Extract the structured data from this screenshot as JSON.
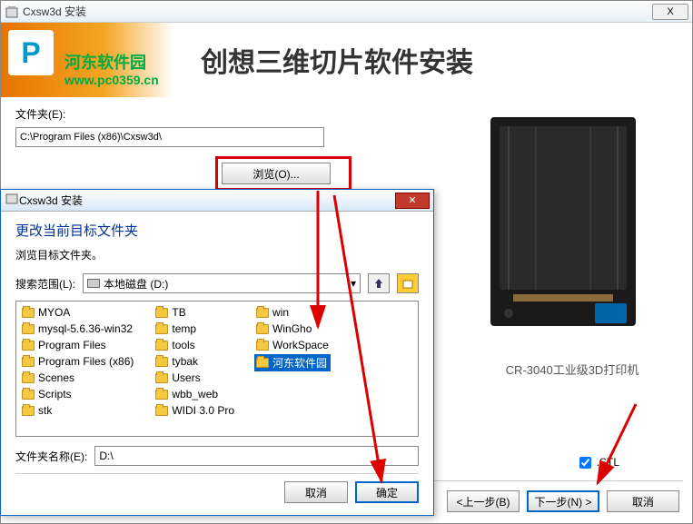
{
  "main_window": {
    "title": "Cxsw3d 安装",
    "close": "X"
  },
  "banner": {
    "title": "创想三维切片软件安装",
    "watermark_text": "河东软件园",
    "watermark_url": "www.pc0359.cn"
  },
  "folder": {
    "label": "文件夹(E):",
    "path": "C:\\Program Files (x86)\\Cxsw3d\\",
    "browse": "浏览(O)..."
  },
  "printer": {
    "caption": "CR-3040工业级3D打印机"
  },
  "stl_label": ".STL",
  "main_buttons": {
    "back": "<上一步(B)",
    "next": "下一步(N) >",
    "cancel": "取消"
  },
  "browse_dialog": {
    "title": "Cxsw3d 安装",
    "heading": "更改当前目标文件夹",
    "sub": "浏览目标文件夹。",
    "search_label": "搜索范围(L):",
    "drive": "本地磁盘 (D:)",
    "name_label": "文件夹名称(E):",
    "name_value": "D:\\",
    "cancel": "取消",
    "ok": "确定",
    "folders_col1": [
      "MYOA",
      "mysql-5.6.36-win32",
      "Program Files",
      "Program Files (x86)",
      "Scenes",
      "Scripts",
      "stk"
    ],
    "folders_col2": [
      "TB",
      "temp",
      "tools",
      "tybak",
      "Users",
      "wbb_web",
      "WIDI 3.0 Pro"
    ],
    "folders_col3": [
      "win",
      "WinGho",
      "WorkSpace",
      "河东软件园"
    ]
  }
}
